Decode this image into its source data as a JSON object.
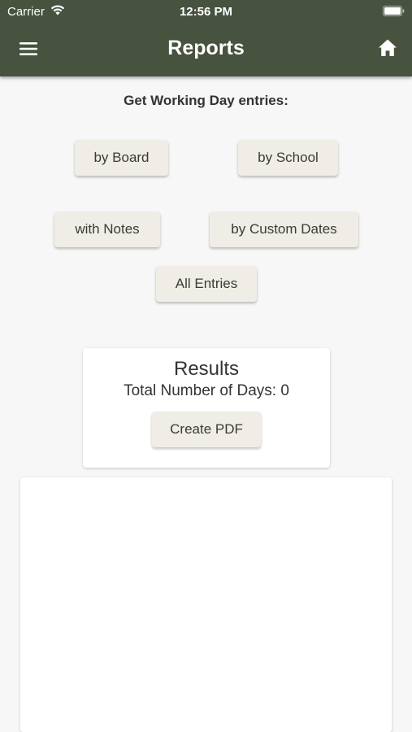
{
  "status_bar": {
    "carrier": "Carrier",
    "time": "12:56 PM",
    "icons": [
      "wifi-icon",
      "battery-icon"
    ]
  },
  "nav": {
    "title": "Reports",
    "left_icon": "menu-icon",
    "right_icon": "home-icon"
  },
  "filters": {
    "heading": "Get Working Day entries:",
    "by_board": "by Board",
    "by_school": "by School",
    "with_notes": "with Notes",
    "by_custom_dates": "by Custom Dates",
    "all_entries": "All Entries"
  },
  "results": {
    "title": "Results",
    "total_label": "Total Number of Days: 0",
    "create_pdf": "Create PDF"
  },
  "colors": {
    "header_bg": "#47523f",
    "button_bg": "#efede6",
    "page_bg": "#f7f7f7"
  }
}
